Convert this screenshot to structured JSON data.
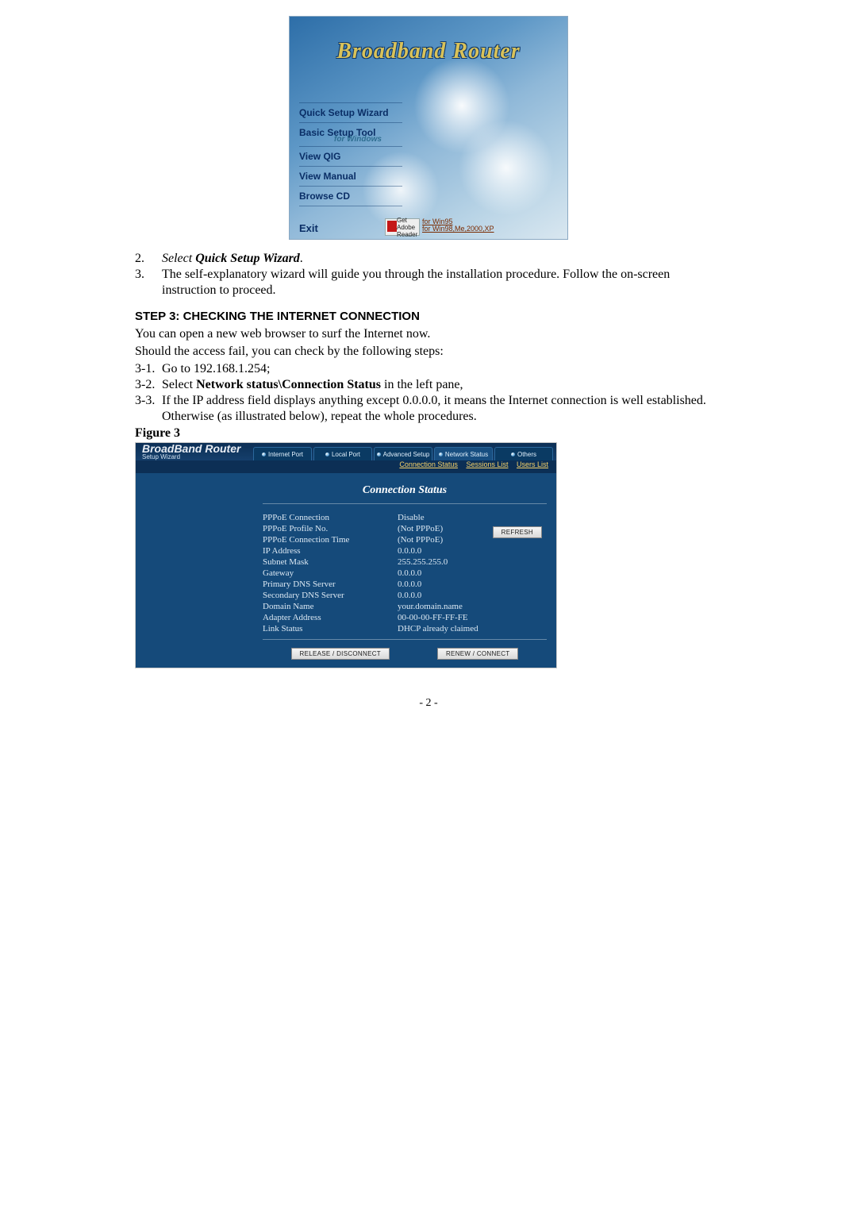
{
  "cd": {
    "title": "Broadband Router",
    "menu": [
      {
        "label": "Quick Setup Wizard"
      },
      {
        "label": "Basic Setup Tool",
        "sub": "for Windows"
      },
      {
        "label": "View QIG"
      },
      {
        "label": "View Manual"
      },
      {
        "label": "Browse CD"
      }
    ],
    "exit": "Exit",
    "adobe": {
      "badge": "Get Adobe Reader",
      "link1": "for Win95",
      "link2": "for Win98,Me,2000,XP"
    }
  },
  "steps_a": [
    {
      "n": "2.",
      "prefix": "Select ",
      "bold": "Quick Setup Wizard",
      "suffix": "."
    },
    {
      "n": "3.",
      "text": "The self-explanatory wizard will guide you through the installation procedure. Follow the on-screen instruction to proceed."
    }
  ],
  "step3_heading": "STEP 3: CHECKING THE INTERNET CONNECTION",
  "step3_intro1": "You can open a new web browser to surf the Internet now.",
  "step3_intro2": "Should the access fail, you can check by the following steps:",
  "steps_b": [
    {
      "n": "3-1.",
      "text": "Go to 192.168.1.254;"
    },
    {
      "n": "3-2.",
      "prefix": "Select ",
      "bold": "Network status\\Connection Status",
      "suffix": " in the left pane,"
    },
    {
      "n": "3-3.",
      "text": "If the IP address field displays anything except 0.0.0.0, it means the Internet connection is well established.  Otherwise (as illustrated below), repeat the whole procedures."
    }
  ],
  "figure3_label": "Figure 3",
  "router": {
    "logo_big": "BroadBand Router",
    "logo_small": "Setup Wizard",
    "tabs": [
      "Internet Port",
      "Local Port",
      "Advanced Setup",
      "Network Status",
      "Others"
    ],
    "sublinks": [
      "Connection Status",
      "Sessions List",
      "Users List"
    ],
    "section_title": "Connection Status",
    "refresh": "REFRESH",
    "rows": [
      {
        "k": "PPPoE Connection",
        "v": "Disable"
      },
      {
        "k": "PPPoE Profile No.",
        "v": "(Not PPPoE)"
      },
      {
        "k": "PPPoE Connection Time",
        "v": "(Not PPPoE)"
      },
      {
        "k": "IP Address",
        "v": "0.0.0.0"
      },
      {
        "k": "Subnet Mask",
        "v": "255.255.255.0"
      },
      {
        "k": "Gateway",
        "v": "0.0.0.0"
      },
      {
        "k": "Primary DNS Server",
        "v": "0.0.0.0"
      },
      {
        "k": "Secondary DNS Server",
        "v": "0.0.0.0"
      },
      {
        "k": "Domain Name",
        "v": "your.domain.name"
      },
      {
        "k": "Adapter Address",
        "v": "00-00-00-FF-FF-FE"
      },
      {
        "k": "Link Status",
        "v": "DHCP already claimed"
      }
    ],
    "btn_release": "RELEASE / DISCONNECT",
    "btn_renew": "RENEW / CONNECT"
  },
  "page_number": "- 2 -"
}
